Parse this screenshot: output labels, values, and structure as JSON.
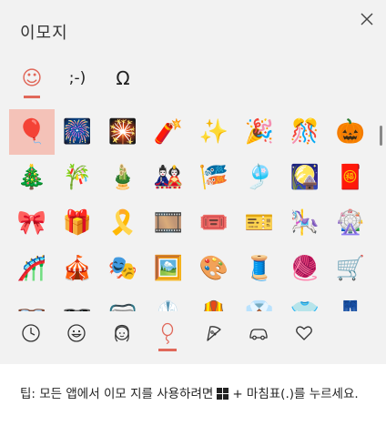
{
  "window": {
    "title": "이모지"
  },
  "tabs": [
    {
      "name": "emoji",
      "glyph": "☺"
    },
    {
      "name": "kaomoji",
      "glyph": ";-)"
    },
    {
      "name": "symbols",
      "glyph": "Ω"
    }
  ],
  "emoji_grid": [
    [
      "🎈",
      "🎆",
      "🎇",
      "🧨",
      "✨",
      "🎉",
      "🎊",
      "🎃"
    ],
    [
      "🎄",
      "🎋",
      "🎍",
      "🎎",
      "🎏",
      "🎐",
      "🎑",
      "🧧"
    ],
    [
      "🎀",
      "🎁",
      "🎗️",
      "🎞️",
      "🎟️",
      "🎫",
      "🎠",
      "🎡"
    ],
    [
      "🎢",
      "🎪",
      "🎭",
      "🖼️",
      "🎨",
      "🧵",
      "🧶",
      "🛒"
    ],
    [
      "👓",
      "🕶️",
      "🥽",
      "🥼",
      "🦺",
      "👔",
      "👕",
      "👖"
    ]
  ],
  "categories": [
    {
      "name": "recent",
      "icon": "clock-icon"
    },
    {
      "name": "smileys",
      "icon": "smiley-icon"
    },
    {
      "name": "people",
      "icon": "person-icon"
    },
    {
      "name": "celebration",
      "icon": "balloon-icon"
    },
    {
      "name": "food",
      "icon": "pizza-icon"
    },
    {
      "name": "travel",
      "icon": "car-icon"
    },
    {
      "name": "symbols",
      "icon": "heart-icon"
    }
  ],
  "footer": {
    "tip_prefix": "팁: 모든 앱에서 이모 지를 사용하려면",
    "tip_suffix": "+ 마침표(.)를 누르세요."
  },
  "colors": {
    "accent": "#e0685a",
    "selected_bg": "#f4c2b8"
  }
}
